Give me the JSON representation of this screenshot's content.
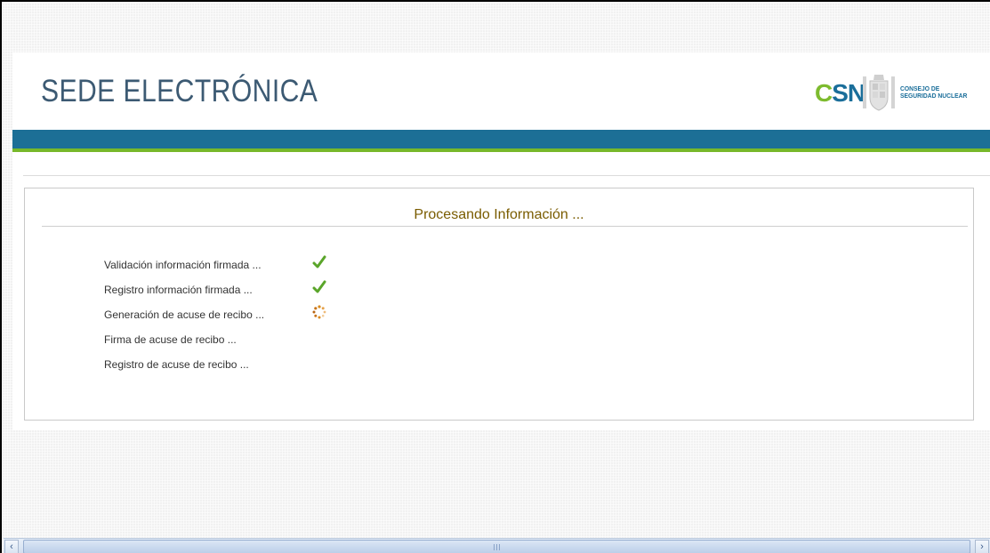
{
  "header": {
    "title": "SEDE ELECTRÓNICA",
    "logo": {
      "abbr_first": "C",
      "abbr_rest": "SN",
      "line1": "CONSEJO DE",
      "line2": "SEGURIDAD NUCLEAR"
    }
  },
  "panel": {
    "title": "Procesando Información ..."
  },
  "steps": [
    {
      "label": "Validación información firmada ...",
      "status": "done",
      "icon": "checkmark-icon"
    },
    {
      "label": "Registro información firmada ...",
      "status": "done",
      "icon": "checkmark-icon"
    },
    {
      "label": "Generación de acuse de recibo ...",
      "status": "in-progress",
      "icon": "loading-spinner-icon"
    },
    {
      "label": "Firma de acuse de recibo ...",
      "status": "pending"
    },
    {
      "label": "Registro de acuse de recibo ...",
      "status": "pending"
    }
  ],
  "colors": {
    "title": "#3c5a73",
    "blue_bar": "#1c6f96",
    "green_bar": "#77b82a",
    "panel_title": "#7a5c00",
    "check": "#5aa52a",
    "spinner": "#d98a1e"
  }
}
